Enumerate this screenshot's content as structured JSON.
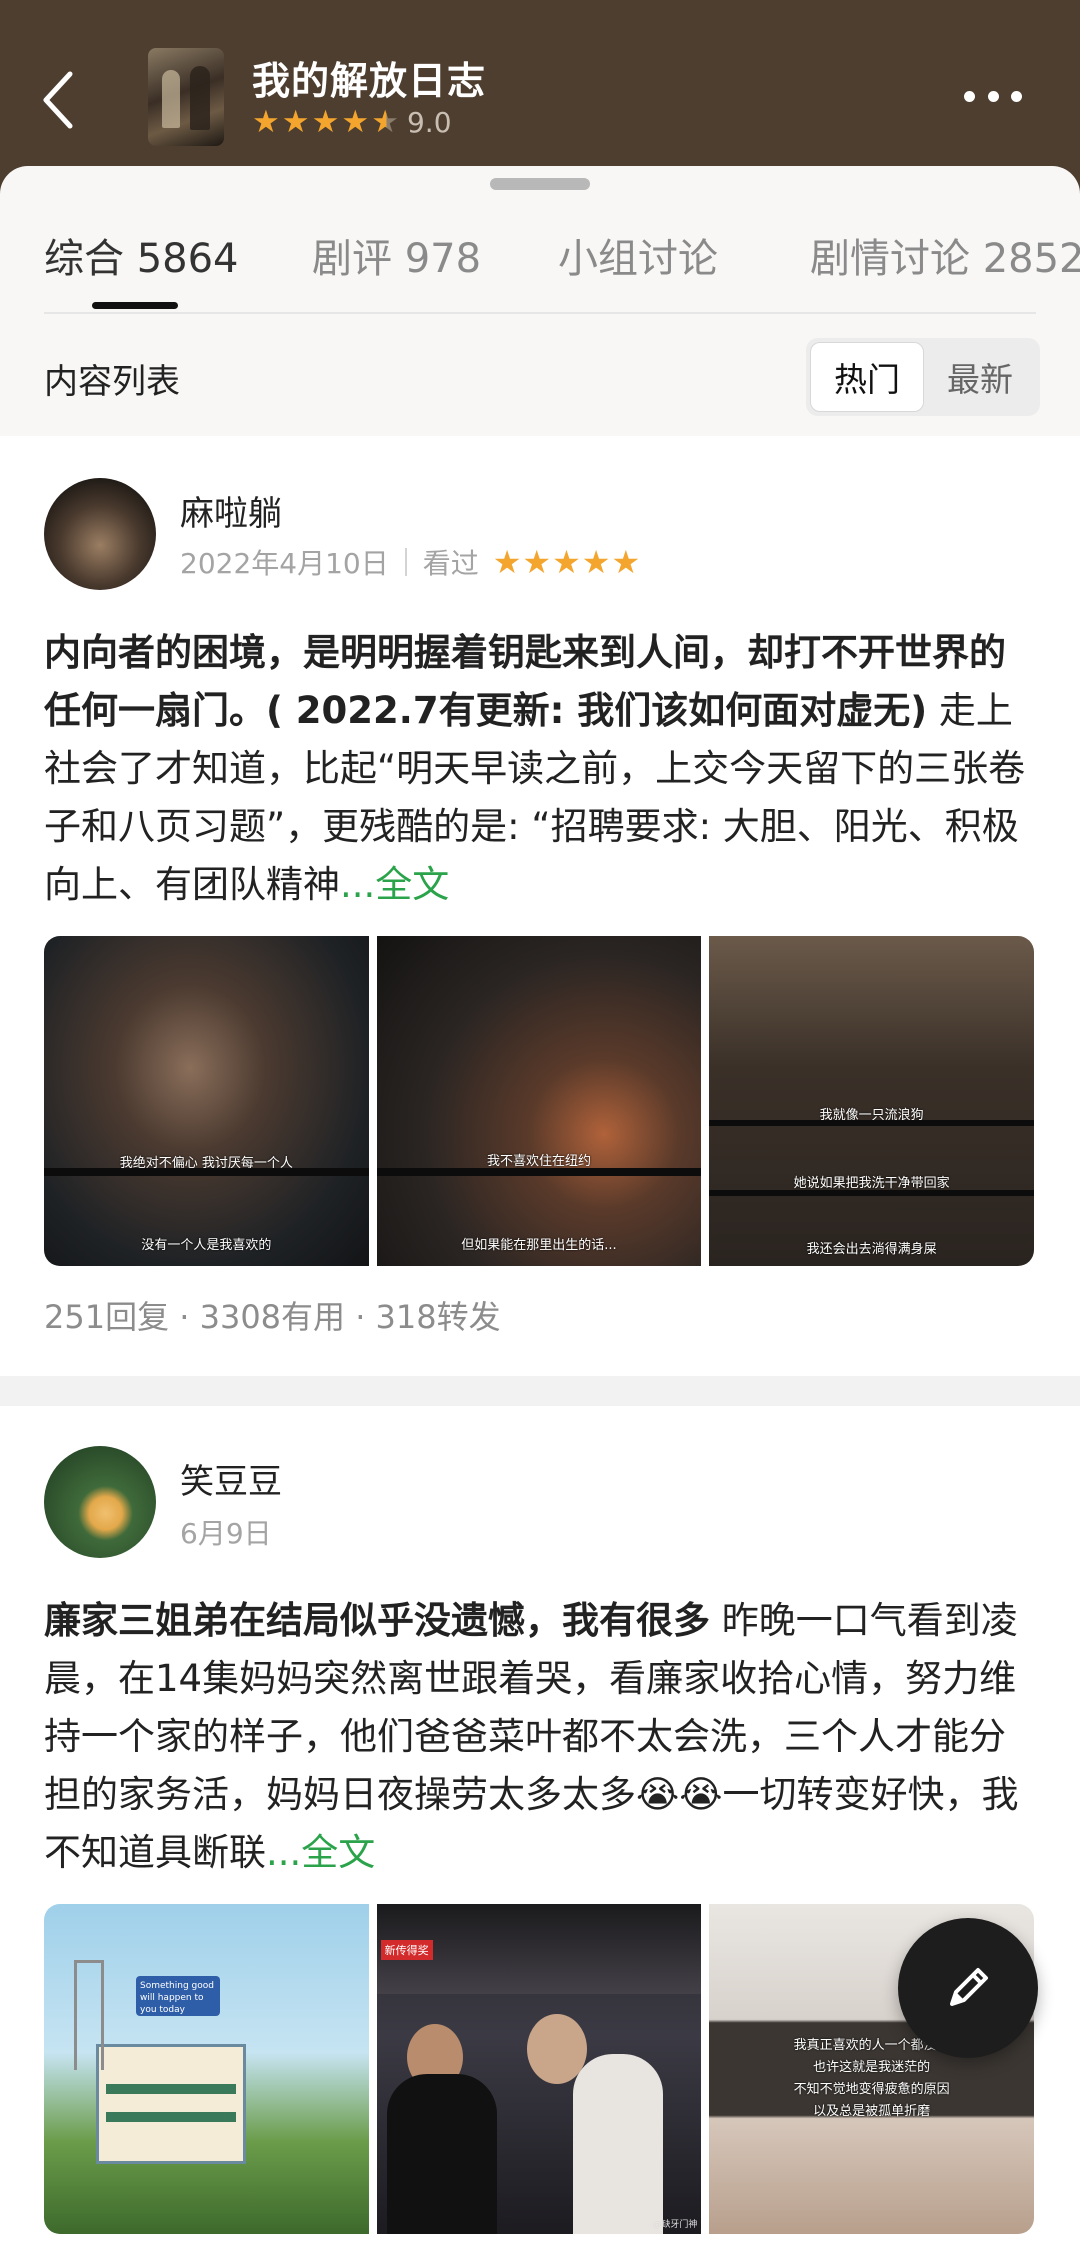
{
  "header": {
    "title": "我的解放日志",
    "rating": "9.0"
  },
  "tabs": [
    {
      "label": "综合 5864",
      "active": true
    },
    {
      "label": "剧评 978",
      "active": false
    },
    {
      "label": "小组讨论",
      "active": false
    },
    {
      "label": "剧情讨论 2852",
      "active": false
    }
  ],
  "list": {
    "label": "内容列表",
    "sort_hot": "热门",
    "sort_new": "最新"
  },
  "reviews": [
    {
      "user": "麻啦躺",
      "date": "2022年4月10日",
      "status": "看过",
      "stars": "★★★★★",
      "title": "内向者的困境，是明明握着钥匙来到人间，却打不开世界的任何一扇门。( 2022.7有更新: 我们该如何面对虚无)",
      "excerpt": " 走上社会了才知道，比起“明天早读之前，上交今天留下的三张卷子和八页习题”，更残酷的是: “招聘要求: 大胆、阳光、积极向上、有团队精神",
      "more": "...全文",
      "images": [
        {
          "subs": [
            "我绝对不偏心 我讨厌每一个人",
            "没有一个人是我喜欢的"
          ]
        },
        {
          "subs": [
            "我不喜欢住在纽约",
            "但如果能在那里出生的话..."
          ]
        },
        {
          "subs": [
            "我就像一只流浪狗",
            "她说如果把我洗干净带回家",
            "我还会出去淌得满身屎"
          ]
        }
      ],
      "stats": "251回复 · 3308有用 · 318转发"
    },
    {
      "user": "笑豆豆",
      "date": "6月9日",
      "title": "廉家三姐弟在结局似乎没遗憾，我有很多",
      "excerpt": " 昨晚一口气看到凌晨，在14集妈妈突然离世跟着哭，看廉家收拾心情，努力维持一个家的样子，他们爸爸菜叶都不太会洗，三个人才能分担的家务活，妈妈日夜操劳太多太多😭😭一切转变好快，我不知道具断联",
      "more": "...全文",
      "images": [
        {
          "sign": "Something good will happen to you today"
        },
        {
          "tag": "新传得奖",
          "watermark": "@缺牙门神"
        },
        {
          "subs": [
            "我真正喜欢的人一个都没有",
            "也许这就是我迷茫的",
            "不知不觉地变得疲惫的原因",
            "以及总是被孤单折磨"
          ]
        }
      ]
    }
  ]
}
